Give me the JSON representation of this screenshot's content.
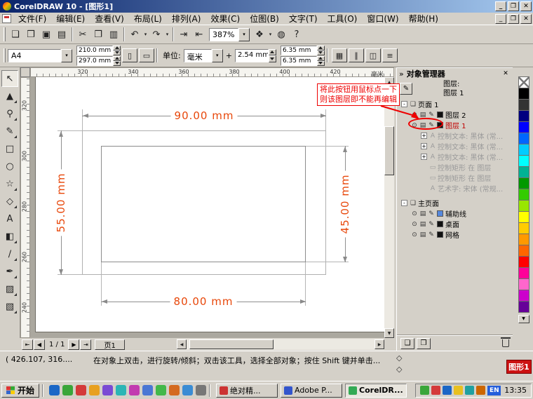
{
  "window": {
    "title": "CorelDRAW 10 - [图形1]"
  },
  "icons": {
    "minimize": "_",
    "maximize": "❐",
    "close": "✕",
    "dropdown": "▾",
    "chevrons": "»",
    "eye": "⊙",
    "printer": "▤",
    "pencil": "✎",
    "page": "❏",
    "portrait": "▯",
    "landscape": "▭",
    "up": "▲",
    "down": "▼",
    "left": "◀",
    "right": "▶",
    "first": "⇤",
    "last": "⇥",
    "diamond": "◇",
    "nudge": "+",
    "new_layer": "❑",
    "new_master_layer": "❒"
  },
  "menubar": {
    "items": [
      "文件(F)",
      "编辑(E)",
      "查看(V)",
      "布局(L)",
      "排列(A)",
      "效果(C)",
      "位图(B)",
      "文字(T)",
      "工具(O)",
      "窗口(W)",
      "帮助(H)"
    ]
  },
  "std_toolbar": {
    "zoom_value": "387%",
    "buttons_left": [
      {
        "name": "new-document-button",
        "glyph": "❑"
      },
      {
        "name": "open-button",
        "glyph": "❒"
      },
      {
        "name": "save-button",
        "glyph": "▣"
      },
      {
        "name": "print-button",
        "glyph": "▤"
      },
      {
        "sep": true
      },
      {
        "name": "cut-button",
        "glyph": "✂"
      },
      {
        "name": "copy-button",
        "glyph": "❐"
      },
      {
        "name": "paste-button",
        "glyph": "▥"
      },
      {
        "sep": true
      },
      {
        "name": "undo-button",
        "glyph": "↶",
        "dropdown": true
      },
      {
        "name": "redo-button",
        "glyph": "↷",
        "dropdown": true
      },
      {
        "sep": true
      },
      {
        "name": "import-button",
        "glyph": "⇥"
      },
      {
        "name": "export-button",
        "glyph": "⇤"
      }
    ],
    "buttons_right": [
      {
        "name": "application-launcher-button",
        "glyph": "❖",
        "dropdown": true
      },
      {
        "name": "corel-online-button",
        "glyph": "◍"
      },
      {
        "name": "help-button",
        "glyph": "?"
      }
    ]
  },
  "property_bar": {
    "paper_size_value": "A4",
    "paper_width": "210.0 mm",
    "paper_height": "297.0 mm",
    "units_label": "单位:",
    "units_value": "毫米",
    "nudge_value": "2.54 mm",
    "duplicate_x": "6.35 mm",
    "duplicate_y": "6.35 mm",
    "buttons": [
      {
        "name": "snap-to-grid-button",
        "glyph": "▦"
      },
      {
        "name": "snap-to-guidelines-button",
        "glyph": "∥"
      },
      {
        "name": "snap-to-objects-button",
        "glyph": "◫"
      },
      {
        "name": "options-button",
        "glyph": "≡"
      }
    ]
  },
  "toolbox": {
    "tools": [
      {
        "name": "pick-tool",
        "glyph": "↖",
        "flyout": false
      },
      {
        "name": "shape-tool",
        "glyph": "▲",
        "flyout": true
      },
      {
        "name": "zoom-tool",
        "glyph": "⚲",
        "flyout": true
      },
      {
        "name": "freehand-tool",
        "glyph": "✎",
        "flyout": true
      },
      {
        "name": "rectangle-tool",
        "glyph": "□",
        "flyout": false
      },
      {
        "name": "ellipse-tool",
        "glyph": "○",
        "flyout": false
      },
      {
        "name": "polygon-tool",
        "glyph": "☆",
        "flyout": true
      },
      {
        "name": "basic-shapes-tool",
        "glyph": "◇",
        "flyout": true
      },
      {
        "name": "text-tool",
        "glyph": "A",
        "flyout": false
      },
      {
        "name": "interactive-blend-tool",
        "glyph": "◧",
        "flyout": true
      },
      {
        "name": "eyedropper-tool",
        "glyph": "∕",
        "flyout": true
      },
      {
        "name": "outline-tool",
        "glyph": "✒",
        "flyout": true
      },
      {
        "name": "fill-tool",
        "glyph": "▨",
        "flyout": true
      },
      {
        "name": "interactive-fill-tool",
        "glyph": "▧",
        "flyout": true
      }
    ]
  },
  "rulers": {
    "h_ticks": [
      "320",
      "340",
      "360",
      "380",
      "400",
      "420"
    ],
    "v_ticks": [
      "320",
      "300",
      "280",
      "260",
      "240"
    ],
    "unit": "毫米"
  },
  "canvas": {
    "dim_top": "90.00 mm",
    "dim_left": "55.00 mm",
    "dim_right": "45.00 mm",
    "dim_bottom": "80.00 mm"
  },
  "callout": {
    "line1": "将此按钮用鼠标点一下",
    "line2": "则该图层即不能再编辑"
  },
  "docker": {
    "title": "对象管理器",
    "layer_label": "图层:",
    "active_layer": "图层 1",
    "page_node": "页面 1",
    "layers": [
      {
        "label": "图层 2",
        "red": false,
        "swatch": "#111111"
      },
      {
        "label": "图层 1",
        "red": true,
        "swatch": "#111111"
      }
    ],
    "objects": [
      {
        "label": "控制文本: 黑体 (常...",
        "icon": "A",
        "expand": true
      },
      {
        "label": "控制文本: 黑体 (常...",
        "icon": "A",
        "expand": true
      },
      {
        "label": "控制文本: 黑体 (常...",
        "icon": "A",
        "expand": true
      },
      {
        "label": "控制矩形 在 图层",
        "icon": "▭",
        "expand": false
      },
      {
        "label": "控制矩形 在 图层",
        "icon": "▭",
        "expand": false
      },
      {
        "label": "艺术字: 宋体 (常规...",
        "icon": "A",
        "expand": false
      }
    ],
    "master_node": "主页面",
    "master_layers": [
      {
        "label": "辅助线",
        "swatch": "#5588dd"
      },
      {
        "label": "桌面",
        "swatch": "#111111"
      },
      {
        "label": "网格",
        "swatch": "#111111"
      }
    ]
  },
  "palette": {
    "colors": [
      "#000000",
      "#333333",
      "#000080",
      "#0000ff",
      "#0066ff",
      "#00ccff",
      "#00ffff",
      "#00b394",
      "#009900",
      "#33cc00",
      "#99e600",
      "#ffff00",
      "#ffcc00",
      "#ff9900",
      "#ff6600",
      "#ff0000",
      "#ff0099",
      "#ff66cc",
      "#cc00cc",
      "#660099"
    ]
  },
  "page_bar": {
    "indicator": "1 / 1",
    "tab": "页1"
  },
  "status_bar": {
    "coords": "( 426.107, 316....",
    "hint": "在对象上双击，进行旋转/倾斜；双击该工具，选择全部对象；按住 Shift 键并单击...",
    "badge": "图形1"
  },
  "taskbar": {
    "start": "开始",
    "tasks": [
      {
        "label": "绝对精...",
        "color": "#cc3333",
        "active": false
      },
      {
        "label": "Adobe P...",
        "color": "#3355cc",
        "active": false
      },
      {
        "label": "CorelDR...",
        "color": "#33aa55",
        "active": true
      }
    ],
    "quick_launch": [
      "#1b67c6",
      "#3aa63a",
      "#d43a3a",
      "#e8a020",
      "#7a4bd4",
      "#2bb5b5",
      "#c23ab0",
      "#4a77d4",
      "#42b84a",
      "#d46a20",
      "#3a8cd4",
      "#777777"
    ],
    "tray_icons": [
      "#3aa63a",
      "#d43a3a",
      "#1b67c6",
      "#e8c020",
      "#20a0a0",
      "#cc6600"
    ],
    "lang": "EN",
    "time": "13:35"
  },
  "theme": {
    "chrome": "#d4d0c8",
    "titlebar_start": "#0a246a",
    "titlebar_end": "#a6caf0",
    "dimension_color": "#e8470a",
    "annotation_color": "#ee0000",
    "badge_bg": "#cc1111"
  }
}
